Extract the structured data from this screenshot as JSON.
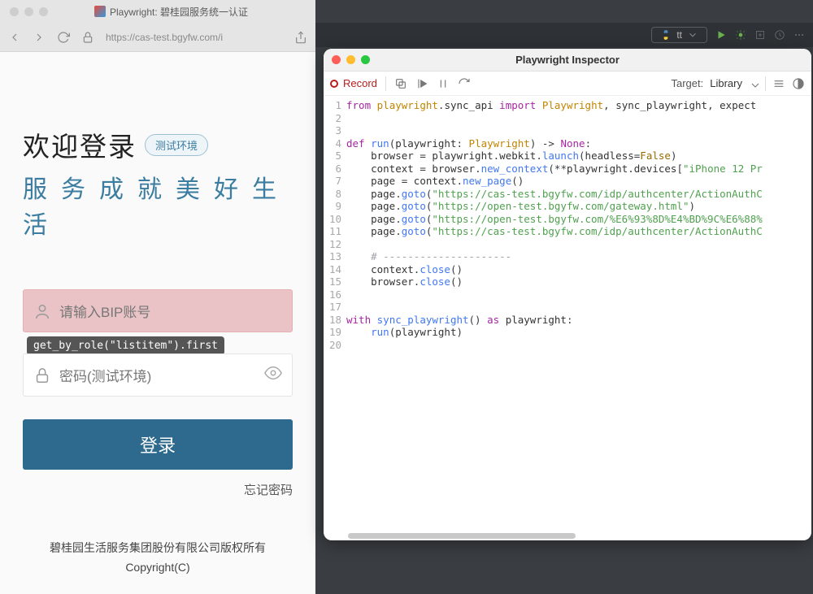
{
  "browser": {
    "window_title": "Playwright: 碧桂园服务统一认证",
    "url": "https://cas-test.bgyfw.com/i"
  },
  "login_page": {
    "welcome": "欢迎登录",
    "env_badge": "测试环境",
    "slogan": "服务成就美好生活",
    "username_placeholder": "请输入BIP账号",
    "password_placeholder": "密码(测试环境)",
    "login_button": "登录",
    "forgot_password": "忘记密码",
    "footer_line1": "碧桂园生活服务集团股份有限公司版权所有",
    "footer_line2": "Copyright(C)",
    "selector_tooltip": "get_by_role(\"listitem\").first"
  },
  "ide_toolbar": {
    "config_name": "tt"
  },
  "inspector": {
    "title": "Playwright Inspector",
    "record_label": "Record",
    "target_label": "Target:",
    "target_value": "Library",
    "code_lines": [
      {
        "n": 1,
        "tokens": [
          [
            "kw",
            "from"
          ],
          [
            "",
            " "
          ],
          [
            "cls",
            "playwright"
          ],
          [
            "op",
            "."
          ],
          [
            "",
            "sync_api "
          ],
          [
            "kw",
            "import"
          ],
          [
            "",
            " "
          ],
          [
            "cls",
            "Playwright"
          ],
          [
            "op",
            ", "
          ],
          [
            "",
            "sync_playwright"
          ],
          [
            "op",
            ", "
          ],
          [
            "",
            "expect"
          ]
        ]
      },
      {
        "n": 2,
        "tokens": [
          [
            "",
            ""
          ]
        ]
      },
      {
        "n": 3,
        "tokens": [
          [
            "",
            ""
          ]
        ]
      },
      {
        "n": 4,
        "tokens": [
          [
            "kw",
            "def"
          ],
          [
            "",
            " "
          ],
          [
            "fn",
            "run"
          ],
          [
            "op",
            "("
          ],
          [
            "",
            "playwright"
          ],
          [
            "op",
            ": "
          ],
          [
            "cls",
            "Playwright"
          ],
          [
            "op",
            ") -> "
          ],
          [
            "none",
            "None"
          ],
          [
            "op",
            ":"
          ]
        ]
      },
      {
        "n": 5,
        "tokens": [
          [
            "",
            "    browser "
          ],
          [
            "op",
            "= "
          ],
          [
            "",
            "playwright"
          ],
          [
            "op",
            "."
          ],
          [
            "",
            "webkit"
          ],
          [
            "op",
            "."
          ],
          [
            "fn",
            "launch"
          ],
          [
            "op",
            "("
          ],
          [
            "",
            "headless"
          ],
          [
            "op",
            "="
          ],
          [
            "bool",
            "False"
          ],
          [
            "op",
            ")"
          ]
        ]
      },
      {
        "n": 6,
        "tokens": [
          [
            "",
            "    context "
          ],
          [
            "op",
            "= "
          ],
          [
            "",
            "browser"
          ],
          [
            "op",
            "."
          ],
          [
            "fn",
            "new_context"
          ],
          [
            "op",
            "(**"
          ],
          [
            "",
            "playwright"
          ],
          [
            "op",
            "."
          ],
          [
            "",
            "devices"
          ],
          [
            "op",
            "["
          ],
          [
            "str",
            "\"iPhone 12 Pr"
          ]
        ]
      },
      {
        "n": 7,
        "tokens": [
          [
            "",
            "    page "
          ],
          [
            "op",
            "= "
          ],
          [
            "",
            "context"
          ],
          [
            "op",
            "."
          ],
          [
            "fn",
            "new_page"
          ],
          [
            "op",
            "()"
          ]
        ]
      },
      {
        "n": 8,
        "tokens": [
          [
            "",
            "    page"
          ],
          [
            "op",
            "."
          ],
          [
            "fn",
            "goto"
          ],
          [
            "op",
            "("
          ],
          [
            "str",
            "\"https://cas-test.bgyfw.com/idp/authcenter/ActionAuthC"
          ]
        ]
      },
      {
        "n": 9,
        "tokens": [
          [
            "",
            "    page"
          ],
          [
            "op",
            "."
          ],
          [
            "fn",
            "goto"
          ],
          [
            "op",
            "("
          ],
          [
            "str",
            "\"https://open-test.bgyfw.com/gateway.html\""
          ],
          [
            "op",
            ")"
          ]
        ]
      },
      {
        "n": 10,
        "tokens": [
          [
            "",
            "    page"
          ],
          [
            "op",
            "."
          ],
          [
            "fn",
            "goto"
          ],
          [
            "op",
            "("
          ],
          [
            "str",
            "\"https://open-test.bgyfw.com/%E6%93%8D%E4%BD%9C%E6%88%"
          ]
        ]
      },
      {
        "n": 11,
        "tokens": [
          [
            "",
            "    page"
          ],
          [
            "op",
            "."
          ],
          [
            "fn",
            "goto"
          ],
          [
            "op",
            "("
          ],
          [
            "str",
            "\"https://cas-test.bgyfw.com/idp/authcenter/ActionAuthC"
          ]
        ]
      },
      {
        "n": 12,
        "tokens": [
          [
            "",
            ""
          ]
        ]
      },
      {
        "n": 13,
        "tokens": [
          [
            "",
            "    "
          ],
          [
            "cm",
            "# ---------------------"
          ]
        ]
      },
      {
        "n": 14,
        "tokens": [
          [
            "",
            "    context"
          ],
          [
            "op",
            "."
          ],
          [
            "fn",
            "close"
          ],
          [
            "op",
            "()"
          ]
        ]
      },
      {
        "n": 15,
        "tokens": [
          [
            "",
            "    browser"
          ],
          [
            "op",
            "."
          ],
          [
            "fn",
            "close"
          ],
          [
            "op",
            "()"
          ]
        ]
      },
      {
        "n": 16,
        "tokens": [
          [
            "",
            ""
          ]
        ]
      },
      {
        "n": 17,
        "tokens": [
          [
            "",
            ""
          ]
        ]
      },
      {
        "n": 18,
        "tokens": [
          [
            "kw",
            "with"
          ],
          [
            "",
            " "
          ],
          [
            "fn",
            "sync_playwright"
          ],
          [
            "op",
            "() "
          ],
          [
            "kw",
            "as"
          ],
          [
            "",
            " playwright"
          ],
          [
            "op",
            ":"
          ]
        ]
      },
      {
        "n": 19,
        "tokens": [
          [
            "",
            "    "
          ],
          [
            "fn",
            "run"
          ],
          [
            "op",
            "("
          ],
          [
            "",
            "playwright"
          ],
          [
            "op",
            ")"
          ]
        ]
      },
      {
        "n": 20,
        "tokens": [
          [
            "",
            ""
          ]
        ]
      }
    ]
  }
}
